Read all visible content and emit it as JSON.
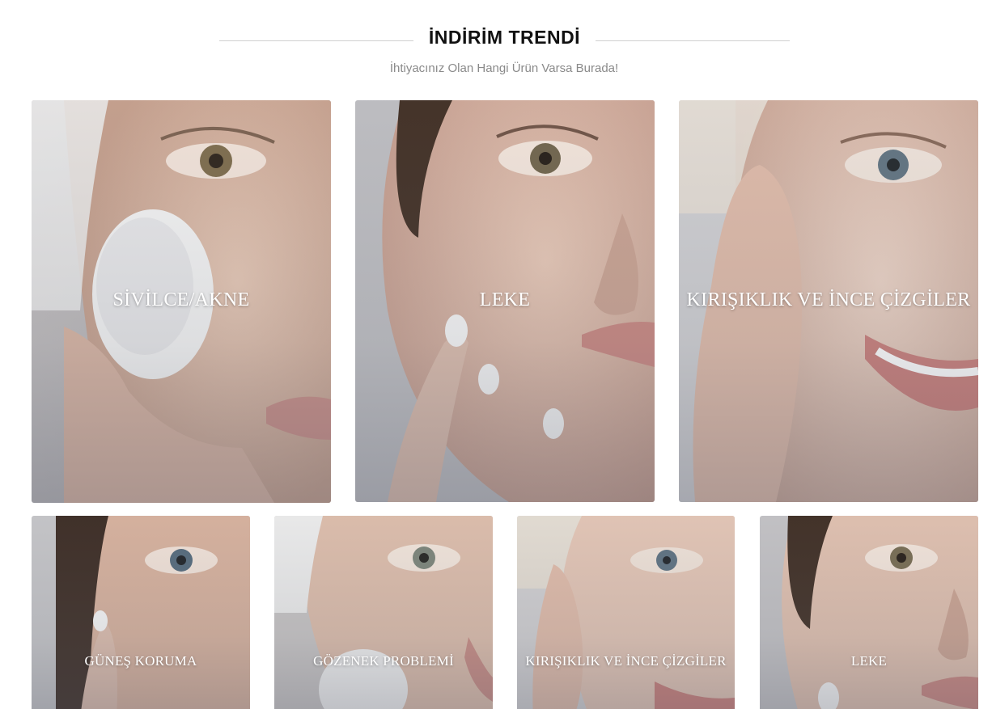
{
  "section": {
    "title": "İNDİRİM TRENDİ",
    "subtitle": "İhtiyacınız Olan Hangi Ürün Varsa Burada!"
  },
  "cards_row1": [
    {
      "label": "SİVİLCE/AKNE"
    },
    {
      "label": "LEKE"
    },
    {
      "label": "KIRIŞIKLIK VE İNCE ÇİZGİLER"
    }
  ],
  "cards_row2": [
    {
      "label": "GÜNEŞ KORUMA"
    },
    {
      "label": "GÖZENEK PROBLEMİ"
    },
    {
      "label": "KIRIŞIKLIK VE İNCE ÇİZGİLER"
    },
    {
      "label": "LEKE"
    }
  ],
  "colors": {
    "skin": "#d9b7a3",
    "skin_shadow": "#b88f7c",
    "background_gray": "#c9c9cc",
    "title": "#111111",
    "subtitle": "#8a8a8a"
  }
}
